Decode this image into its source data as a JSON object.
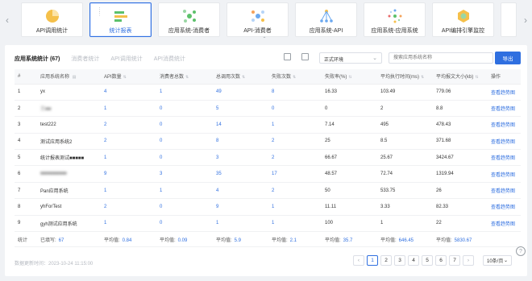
{
  "carousel": {
    "cards": [
      {
        "label": "API调用统计",
        "icon": "pie-chart-icon",
        "active": false
      },
      {
        "label": "统计报表",
        "icon": "report-lines-icon",
        "active": true
      },
      {
        "label": "应用系统-消费者",
        "icon": "node-graph-icon",
        "active": false
      },
      {
        "label": "API-消费者",
        "icon": "hub-graph-icon",
        "active": false
      },
      {
        "label": "应用系统-API",
        "icon": "tree-graph-icon",
        "active": false
      },
      {
        "label": "应用系统-应用系统",
        "icon": "radial-graph-icon",
        "active": false
      },
      {
        "label": "API编排引擎监控",
        "icon": "hexagon-gear-icon",
        "active": false
      }
    ]
  },
  "tabs": [
    {
      "label": "应用系统统计 (67)",
      "active": true
    },
    {
      "label": "消费者统计",
      "active": false
    },
    {
      "label": "API调用统计",
      "active": false
    },
    {
      "label": "API消费统计",
      "active": false
    }
  ],
  "toolbar": {
    "env_select": "正式环境",
    "search_placeholder": "搜索应用系统名称",
    "export_label": "导出"
  },
  "table": {
    "headers": [
      "#",
      "应用系统名称",
      "API数量",
      "消费者总数",
      "总调用次数",
      "失败次数",
      "失败率(%)",
      "平均执行时间(ms)",
      "平均报文大小(kb)",
      "操作"
    ],
    "rows": [
      {
        "idx": "1",
        "name": "yx",
        "api": "4",
        "consumers": "1",
        "calls": "49",
        "fails": "8",
        "rate": "16.33",
        "avg_time": "103.49",
        "avg_size": "779.06",
        "op": "查看趋势图",
        "blur": false
      },
      {
        "idx": "2",
        "name": "王■■",
        "api": "1",
        "consumers": "0",
        "calls": "5",
        "fails": "0",
        "rate": "0",
        "avg_time": "2",
        "avg_size": "8.8",
        "op": "查看趋势图",
        "blur": true
      },
      {
        "idx": "3",
        "name": "test222",
        "api": "2",
        "consumers": "0",
        "calls": "14",
        "fails": "1",
        "rate": "7.14",
        "avg_time": "495",
        "avg_size": "478.43",
        "op": "查看趋势图",
        "blur": false
      },
      {
        "idx": "4",
        "name": "测试应用系统2",
        "api": "2",
        "consumers": "0",
        "calls": "8",
        "fails": "2",
        "rate": "25",
        "avg_time": "8.5",
        "avg_size": "371.68",
        "op": "查看趋势图",
        "blur": false
      },
      {
        "idx": "5",
        "name": "统计报表测试■■■■■",
        "api": "1",
        "consumers": "0",
        "calls": "3",
        "fails": "2",
        "rate": "66.67",
        "avg_time": "25.67",
        "avg_size": "3424.67",
        "op": "查看趋势图",
        "blur": false
      },
      {
        "idx": "6",
        "name": "■■■■■■■■■",
        "api": "9",
        "consumers": "3",
        "calls": "35",
        "fails": "17",
        "rate": "48.57",
        "avg_time": "72.74",
        "avg_size": "1319.94",
        "op": "查看趋势图",
        "blur": true
      },
      {
        "idx": "7",
        "name": "Pan应用系统",
        "api": "1",
        "consumers": "1",
        "calls": "4",
        "fails": "2",
        "rate": "50",
        "avg_time": "533.75",
        "avg_size": "26",
        "op": "查看趋势图",
        "blur": false
      },
      {
        "idx": "8",
        "name": "yhForTest",
        "api": "2",
        "consumers": "0",
        "calls": "9",
        "fails": "1",
        "rate": "11.11",
        "avg_time": "3.33",
        "avg_size": "82.33",
        "op": "查看趋势图",
        "blur": false
      },
      {
        "idx": "9",
        "name": "gyh测试应用系统",
        "api": "1",
        "consumers": "0",
        "calls": "1",
        "fails": "1",
        "rate": "100",
        "avg_time": "1",
        "avg_size": "22",
        "op": "查看趋势图",
        "blur": false
      }
    ],
    "stat": {
      "label": "统计",
      "filled_label": "已填写:",
      "filled_value": "67",
      "avg_label": "平均值:",
      "api_avg": "0.84",
      "consumers_avg": "0.09",
      "calls_avg": "5.9",
      "fails_avg": "2.1",
      "rate_avg": "35.7",
      "time_avg": "646.45",
      "size_avg": "5830.67"
    }
  },
  "footer": {
    "updated": "数据更新时间：2023-10-24 11:15:00",
    "pages": [
      "1",
      "2",
      "3",
      "4",
      "5",
      "6",
      "7"
    ],
    "current_page": "1",
    "page_size": "10条/页"
  },
  "colors": {
    "accent": "#2f6fe0",
    "background": "#f0f2f5"
  }
}
